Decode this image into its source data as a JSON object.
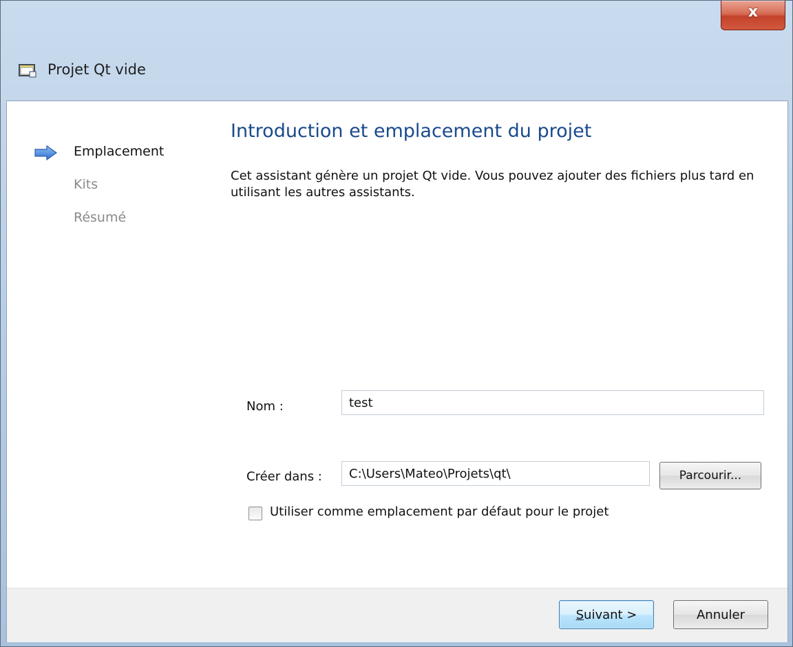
{
  "window": {
    "title": "Projet Qt vide",
    "close_label": "x"
  },
  "nav": {
    "items": [
      {
        "label": "Emplacement",
        "state": "active"
      },
      {
        "label": "Kits",
        "state": "inactive"
      },
      {
        "label": "Résumé",
        "state": "inactive"
      }
    ]
  },
  "page": {
    "title": "Introduction et emplacement du projet",
    "description": "Cet assistant génère un projet Qt vide. Vous pouvez ajouter des fichiers plus tard en utilisant les autres assistants."
  },
  "form": {
    "name_label": "Nom :",
    "name_value": "test",
    "create_in_label": "Créer dans :",
    "create_in_value": "C:\\Users\\Mateo\\Projets\\qt\\",
    "browse_label": "Parcourir...",
    "default_checkbox_label": "Utiliser comme emplacement par défaut pour le projet",
    "default_checked": false
  },
  "footer": {
    "next_mnemonic": "S",
    "next_rest": "uivant >",
    "cancel_label": "Annuler"
  },
  "colors": {
    "title_blue": "#1a4a8c",
    "nav_arrow": "#4a86e8",
    "inactive_text": "#8a8a8a"
  }
}
